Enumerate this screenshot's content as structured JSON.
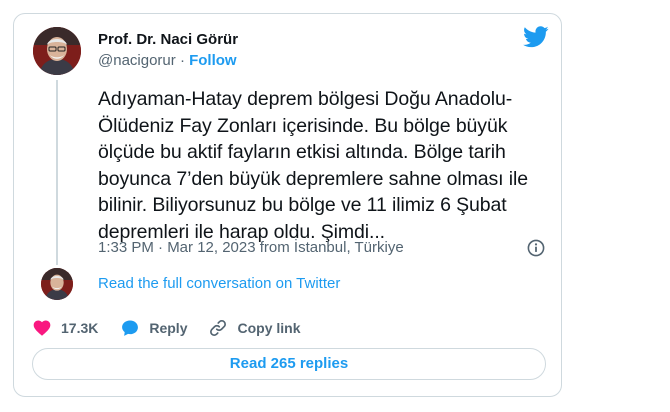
{
  "author": {
    "name": "Prof. Dr. Naci Görür",
    "handle": "@nacigorur",
    "separator": "·",
    "follow_label": "Follow"
  },
  "tweet": {
    "text": "Adıyaman-Hatay deprem bölgesi Doğu Anadolu-\nÖlüdeniz Fay Zonları içerisinde. Bu bölge büyük\nölçüde bu aktif fayların etkisi altında. Bölge tarih\nboyunca 7’den büyük depremlere sahne olması ile\nbilinir. Biliyorsunuz bu bölge ve 11 ilimiz 6 Şubat\ndepremleri ile harap oldu. Şimdi...",
    "timestamp": "1:33 PM · Mar 12, 2023 from İstanbul, Türkiye"
  },
  "conversation": {
    "link_label": "Read the full conversation on Twitter"
  },
  "actions": {
    "like_count": "17.3K",
    "reply_label": "Reply",
    "copy_link_label": "Copy link"
  },
  "replies_button": "Read 265 replies",
  "icons": {
    "logo": "twitter-bird-icon",
    "info": "info-circle-icon",
    "like": "heart-icon",
    "reply": "speech-bubble-icon",
    "copy": "link-icon"
  },
  "colors": {
    "accent": "#1d9bf0",
    "like": "#f91880",
    "text": "#0f1419",
    "secondary": "#536471",
    "border": "#cfd9de"
  }
}
